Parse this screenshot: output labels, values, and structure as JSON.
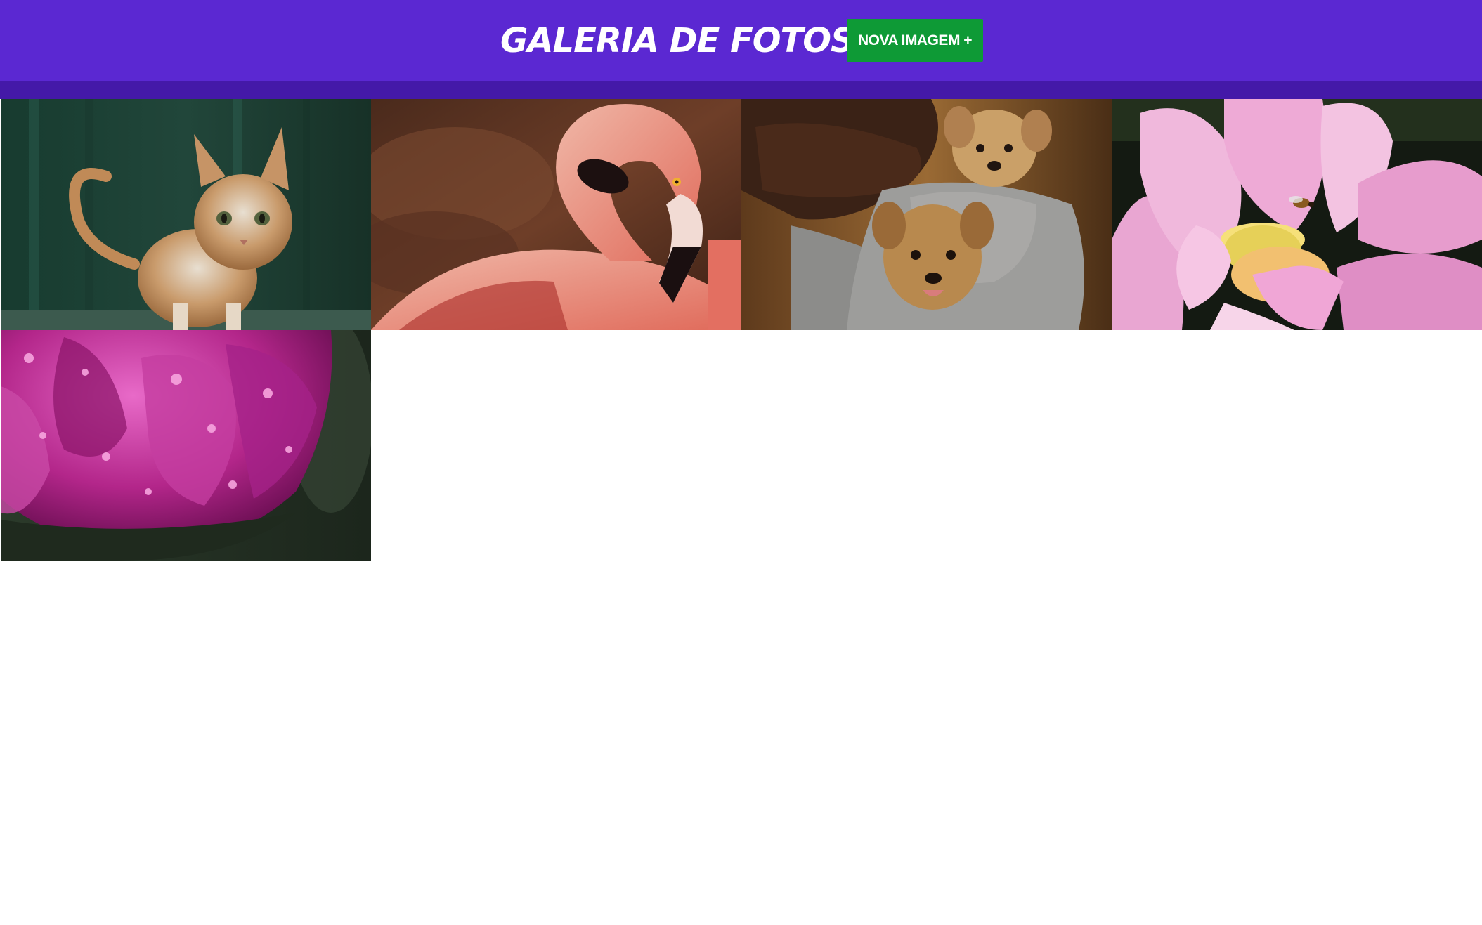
{
  "header": {
    "title": "GALERIA DE FOTOS",
    "new_image_label": "NOVA IMAGEM +",
    "background_color": "#5b28d2",
    "button_color": "#0e9a36"
  },
  "gallery": {
    "images": [
      {
        "subject": "cat-photo"
      },
      {
        "subject": "flamingo-photo"
      },
      {
        "subject": "puppies-photo"
      },
      {
        "subject": "lotus-flower-photo"
      },
      {
        "subject": "purple-tulip-photo"
      }
    ]
  }
}
